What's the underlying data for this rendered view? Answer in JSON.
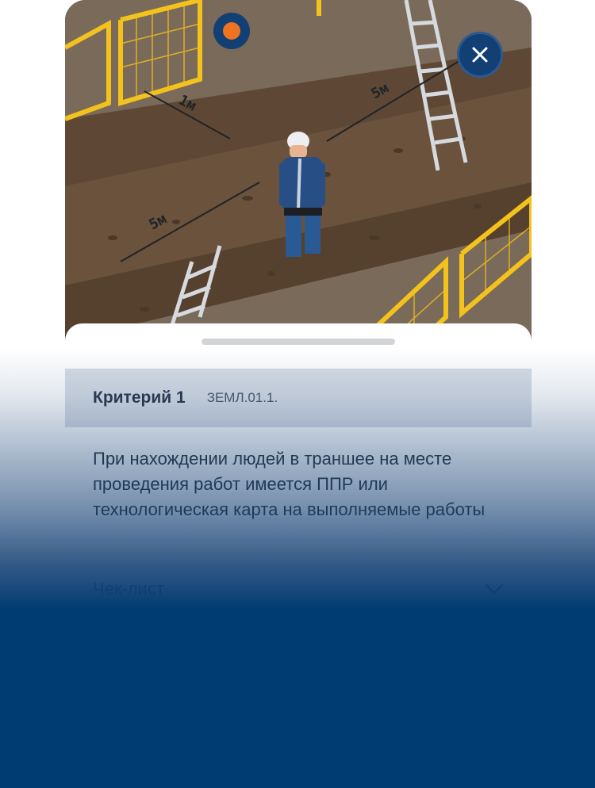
{
  "illustration": {
    "labels": {
      "top_distance": "1м",
      "right_distance": "5м",
      "left_distance": "5м"
    },
    "colors": {
      "ground": "#6e5f4f",
      "trench": "#5b4634",
      "fence": "#f4c21c",
      "worker": "#274f86"
    }
  },
  "controls": {
    "close_icon": "close-icon",
    "marker_color": "#f0731f"
  },
  "sheet": {
    "criterion_title": "Критерий 1",
    "criterion_code": "ЗЕМЛ.01.1.",
    "description": "При нахождении людей в траншее на месте проведения работ имеется ППР или технологическая карта на выполняемые работы",
    "checklist_label": "Чек-лист",
    "checklist_icon": "chevron-down-icon"
  },
  "theme": {
    "overlay_color": "#003b71"
  }
}
